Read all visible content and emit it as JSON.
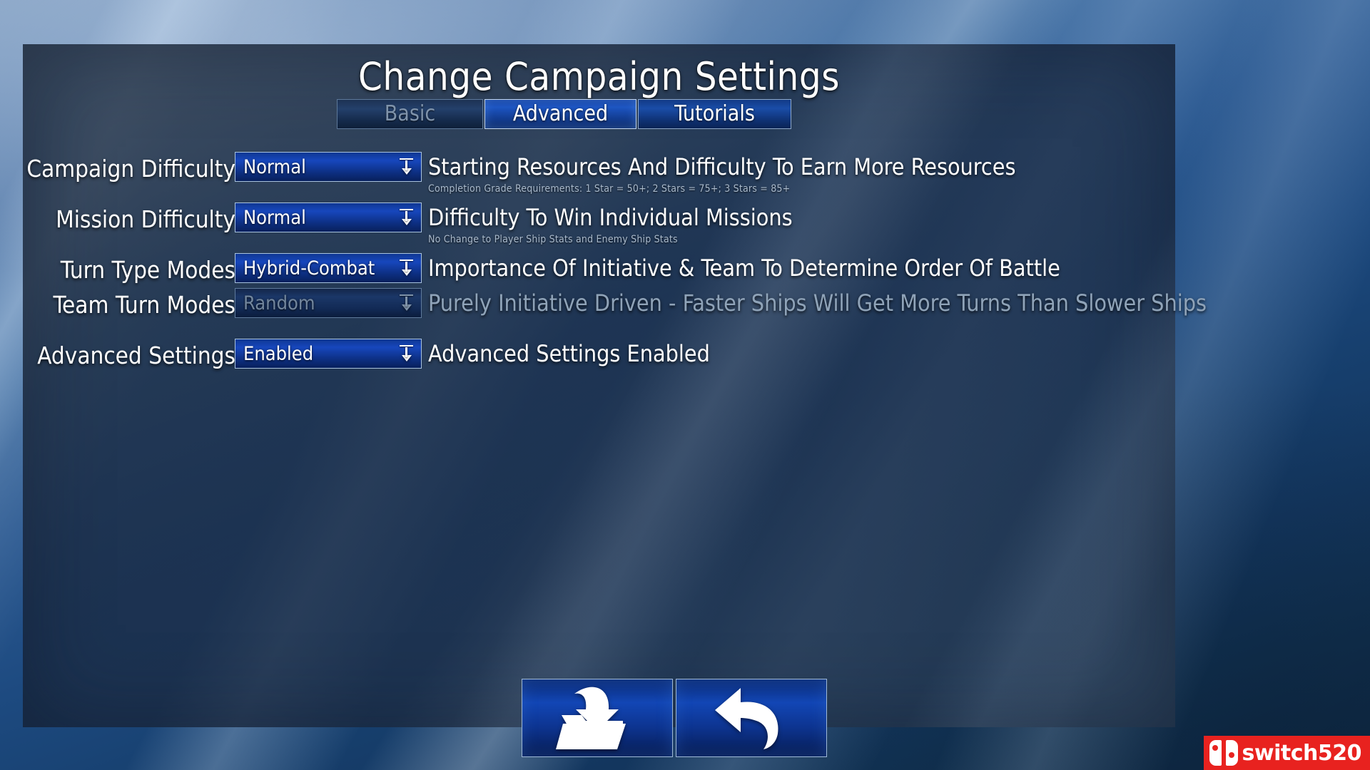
{
  "window": {
    "title": "Change Campaign Settings"
  },
  "tabs": [
    {
      "label": "Basic",
      "state": "dim"
    },
    {
      "label": "Advanced",
      "state": "active"
    },
    {
      "label": "Tutorials",
      "state": "normal"
    }
  ],
  "settings": [
    {
      "label": "Campaign Difficulty",
      "value": "Normal",
      "description": "Starting Resources And Difficulty To Earn More Resources",
      "subtext": "Completion Grade Requirements: 1 Star = 50+; 2 Stars = 75+; 3 Stars = 85+",
      "disabled": false
    },
    {
      "label": "Mission Difficulty",
      "value": "Normal",
      "description": "Difficulty To Win Individual Missions",
      "subtext": "No Change to Player Ship Stats and Enemy Ship Stats",
      "disabled": false
    },
    {
      "label": "Turn Type Modes",
      "value": "Hybrid-Combat",
      "description": "Importance Of Initiative & Team To Determine Order Of Battle",
      "subtext": "",
      "disabled": false
    },
    {
      "label": "Team Turn Modes",
      "value": "Random",
      "description": "Purely Initiative Driven - Faster Ships Will Get More Turns Than Slower Ships",
      "subtext": "",
      "disabled": true
    },
    {
      "label": "Advanced Settings",
      "value": "Enabled",
      "description": "Advanced Settings Enabled",
      "subtext": "",
      "disabled": false
    }
  ],
  "actions": [
    {
      "name": "save-to-folder",
      "icon": "save-folder-icon"
    },
    {
      "name": "back",
      "icon": "back-arrow-icon"
    }
  ],
  "watermark": {
    "text": "switch520",
    "color": "#e8221f"
  },
  "colors": {
    "accent_blue": "#1747bd",
    "panel": "#26344 6",
    "dim_text": "#7f93ab",
    "white": "#ffffff"
  }
}
